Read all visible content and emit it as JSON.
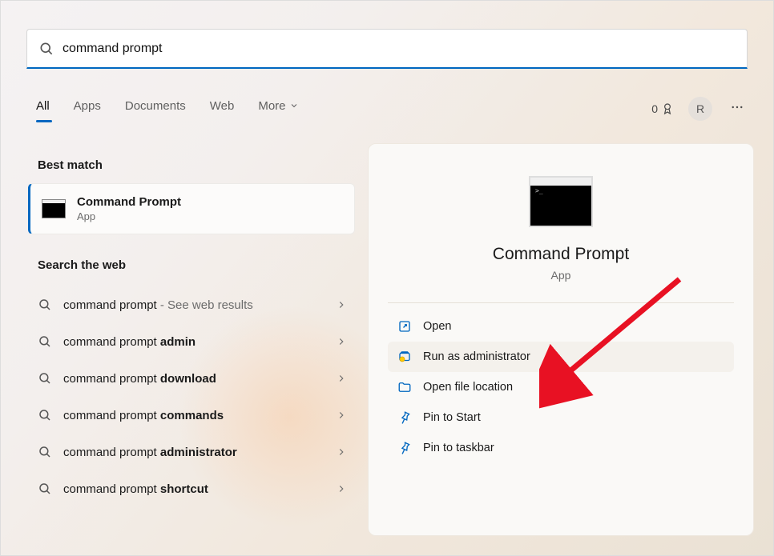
{
  "search": {
    "value": "command prompt"
  },
  "tabs": {
    "all": "All",
    "apps": "Apps",
    "documents": "Documents",
    "web": "Web",
    "more": "More"
  },
  "header": {
    "points": "0",
    "avatar_initial": "R"
  },
  "sections": {
    "best_match": "Best match",
    "search_web": "Search the web"
  },
  "best_match": {
    "title": "Command Prompt",
    "subtitle": "App"
  },
  "web_results": [
    {
      "prefix": "command prompt",
      "bold": "",
      "suffix": " - See web results"
    },
    {
      "prefix": "command prompt ",
      "bold": "admin",
      "suffix": ""
    },
    {
      "prefix": "command prompt ",
      "bold": "download",
      "suffix": ""
    },
    {
      "prefix": "command prompt ",
      "bold": "commands",
      "suffix": ""
    },
    {
      "prefix": "command prompt ",
      "bold": "administrator",
      "suffix": ""
    },
    {
      "prefix": "command prompt ",
      "bold": "shortcut",
      "suffix": ""
    }
  ],
  "panel": {
    "title": "Command Prompt",
    "subtitle": "App",
    "actions": {
      "open": "Open",
      "run_admin": "Run as administrator",
      "open_loc": "Open file location",
      "pin_start": "Pin to Start",
      "pin_taskbar": "Pin to taskbar"
    }
  }
}
